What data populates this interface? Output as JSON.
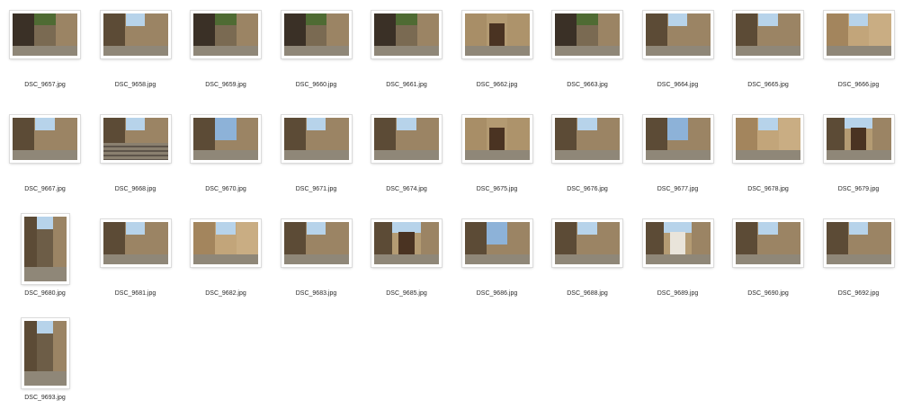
{
  "window": {
    "view": "icon-grid"
  },
  "colors": {
    "stone": "#9b8464",
    "stone_dark": "#5c4b36",
    "sky": "#b7d3ea",
    "foliage": "#4f6b33",
    "shadow": "#3a3026",
    "door": "#4a3322",
    "ground": "#8f8778"
  },
  "files": [
    {
      "name": "DSC_9657.jpg",
      "orientation": "landscape",
      "scene": "foliage-alley"
    },
    {
      "name": "DSC_9658.jpg",
      "orientation": "landscape",
      "scene": "alley"
    },
    {
      "name": "DSC_9659.jpg",
      "orientation": "landscape",
      "scene": "foliage-stairs"
    },
    {
      "name": "DSC_9660.jpg",
      "orientation": "landscape",
      "scene": "foliage-alley"
    },
    {
      "name": "DSC_9661.jpg",
      "orientation": "landscape",
      "scene": "foliage-stairs"
    },
    {
      "name": "DSC_9662.jpg",
      "orientation": "landscape",
      "scene": "door"
    },
    {
      "name": "DSC_9663.jpg",
      "orientation": "landscape",
      "scene": "foliage-alley"
    },
    {
      "name": "DSC_9664.jpg",
      "orientation": "landscape",
      "scene": "alley"
    },
    {
      "name": "DSC_9665.jpg",
      "orientation": "landscape",
      "scene": "alley"
    },
    {
      "name": "DSC_9666.jpg",
      "orientation": "landscape",
      "scene": "alley-bright"
    },
    {
      "name": "DSC_9667.jpg",
      "orientation": "landscape",
      "scene": "alley"
    },
    {
      "name": "DSC_9668.jpg",
      "orientation": "landscape",
      "scene": "stairs"
    },
    {
      "name": "DSC_9670.jpg",
      "orientation": "landscape",
      "scene": "sky-alley"
    },
    {
      "name": "DSC_9671.jpg",
      "orientation": "landscape",
      "scene": "alley"
    },
    {
      "name": "DSC_9674.jpg",
      "orientation": "landscape",
      "scene": "alley"
    },
    {
      "name": "DSC_9675.jpg",
      "orientation": "landscape",
      "scene": "door"
    },
    {
      "name": "DSC_9676.jpg",
      "orientation": "landscape",
      "scene": "alley"
    },
    {
      "name": "DSC_9677.jpg",
      "orientation": "landscape",
      "scene": "sky-alley"
    },
    {
      "name": "DSC_9678.jpg",
      "orientation": "landscape",
      "scene": "alley-bright"
    },
    {
      "name": "DSC_9679.jpg",
      "orientation": "landscape",
      "scene": "square"
    },
    {
      "name": "DSC_9680.jpg",
      "orientation": "portrait",
      "scene": "arch"
    },
    {
      "name": "DSC_9681.jpg",
      "orientation": "landscape",
      "scene": "alley"
    },
    {
      "name": "DSC_9682.jpg",
      "orientation": "landscape",
      "scene": "alley-bright"
    },
    {
      "name": "DSC_9683.jpg",
      "orientation": "landscape",
      "scene": "alley"
    },
    {
      "name": "DSC_9685.jpg",
      "orientation": "landscape",
      "scene": "square"
    },
    {
      "name": "DSC_9686.jpg",
      "orientation": "landscape",
      "scene": "sky-street"
    },
    {
      "name": "DSC_9688.jpg",
      "orientation": "landscape",
      "scene": "alley"
    },
    {
      "name": "DSC_9689.jpg",
      "orientation": "landscape",
      "scene": "house"
    },
    {
      "name": "DSC_9690.jpg",
      "orientation": "landscape",
      "scene": "alley"
    },
    {
      "name": "DSC_9692.jpg",
      "orientation": "landscape",
      "scene": "alley"
    },
    {
      "name": "DSC_9693.jpg",
      "orientation": "portrait",
      "scene": "tower"
    }
  ]
}
